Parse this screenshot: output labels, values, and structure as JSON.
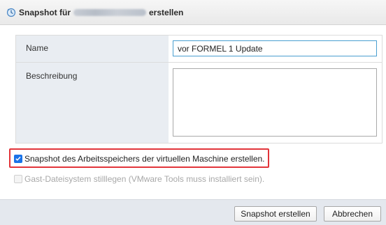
{
  "dialog": {
    "title_prefix": "Snapshot für",
    "title_suffix": "erstellen"
  },
  "form": {
    "name_label": "Name",
    "name_value": "vor FORMEL 1 Update",
    "description_label": "Beschreibung",
    "description_value": ""
  },
  "options": {
    "memory_snapshot_label": "Snapshot des Arbeitsspeichers der virtuellen Maschine erstellen.",
    "memory_snapshot_checked": true,
    "quiesce_label": "Gast-Dateisystem stilllegen (VMware Tools muss installiert sein).",
    "quiesce_checked": false
  },
  "buttons": {
    "create_label": "Snapshot erstellen",
    "cancel_label": "Abbrechen"
  },
  "colors": {
    "highlight": "#e2343a",
    "accent": "#1a73e8"
  }
}
